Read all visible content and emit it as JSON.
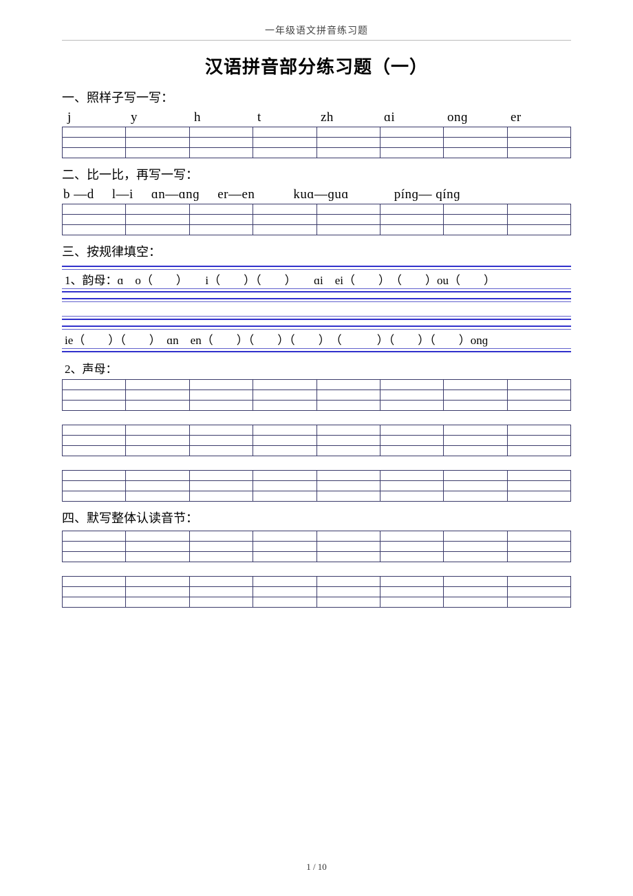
{
  "header": "一年级语文拼音练习题",
  "title": "汉语拼音部分练习题（一）",
  "section1": {
    "heading": "一、照样子写一写：",
    "items": [
      "j",
      "y",
      "h",
      "t",
      "zh",
      "ɑi",
      "onɡ",
      "er"
    ]
  },
  "section2": {
    "heading": "二、比一比，再写一写：",
    "items": [
      "b —d",
      "l—i",
      "ɑn—ɑnɡ",
      "er—en",
      "kuɑ—ɡuɑ",
      "pínɡ— qínɡ"
    ]
  },
  "section3": {
    "heading": "三、按规律填空：",
    "line1": "1、韵母：ɑ　o（　　）　　i（　　）（　　）　　ɑi　ei（　　）　（　　）ou（　　）",
    "line2": "ie（　　）（　　）　ɑn　en（　　）（　　）（　　）　（　　　）（　　）（　　）onɡ",
    "sub2": "2、声母："
  },
  "section4": {
    "heading": "四、默写整体认读音节："
  },
  "footer": "1 / 10"
}
